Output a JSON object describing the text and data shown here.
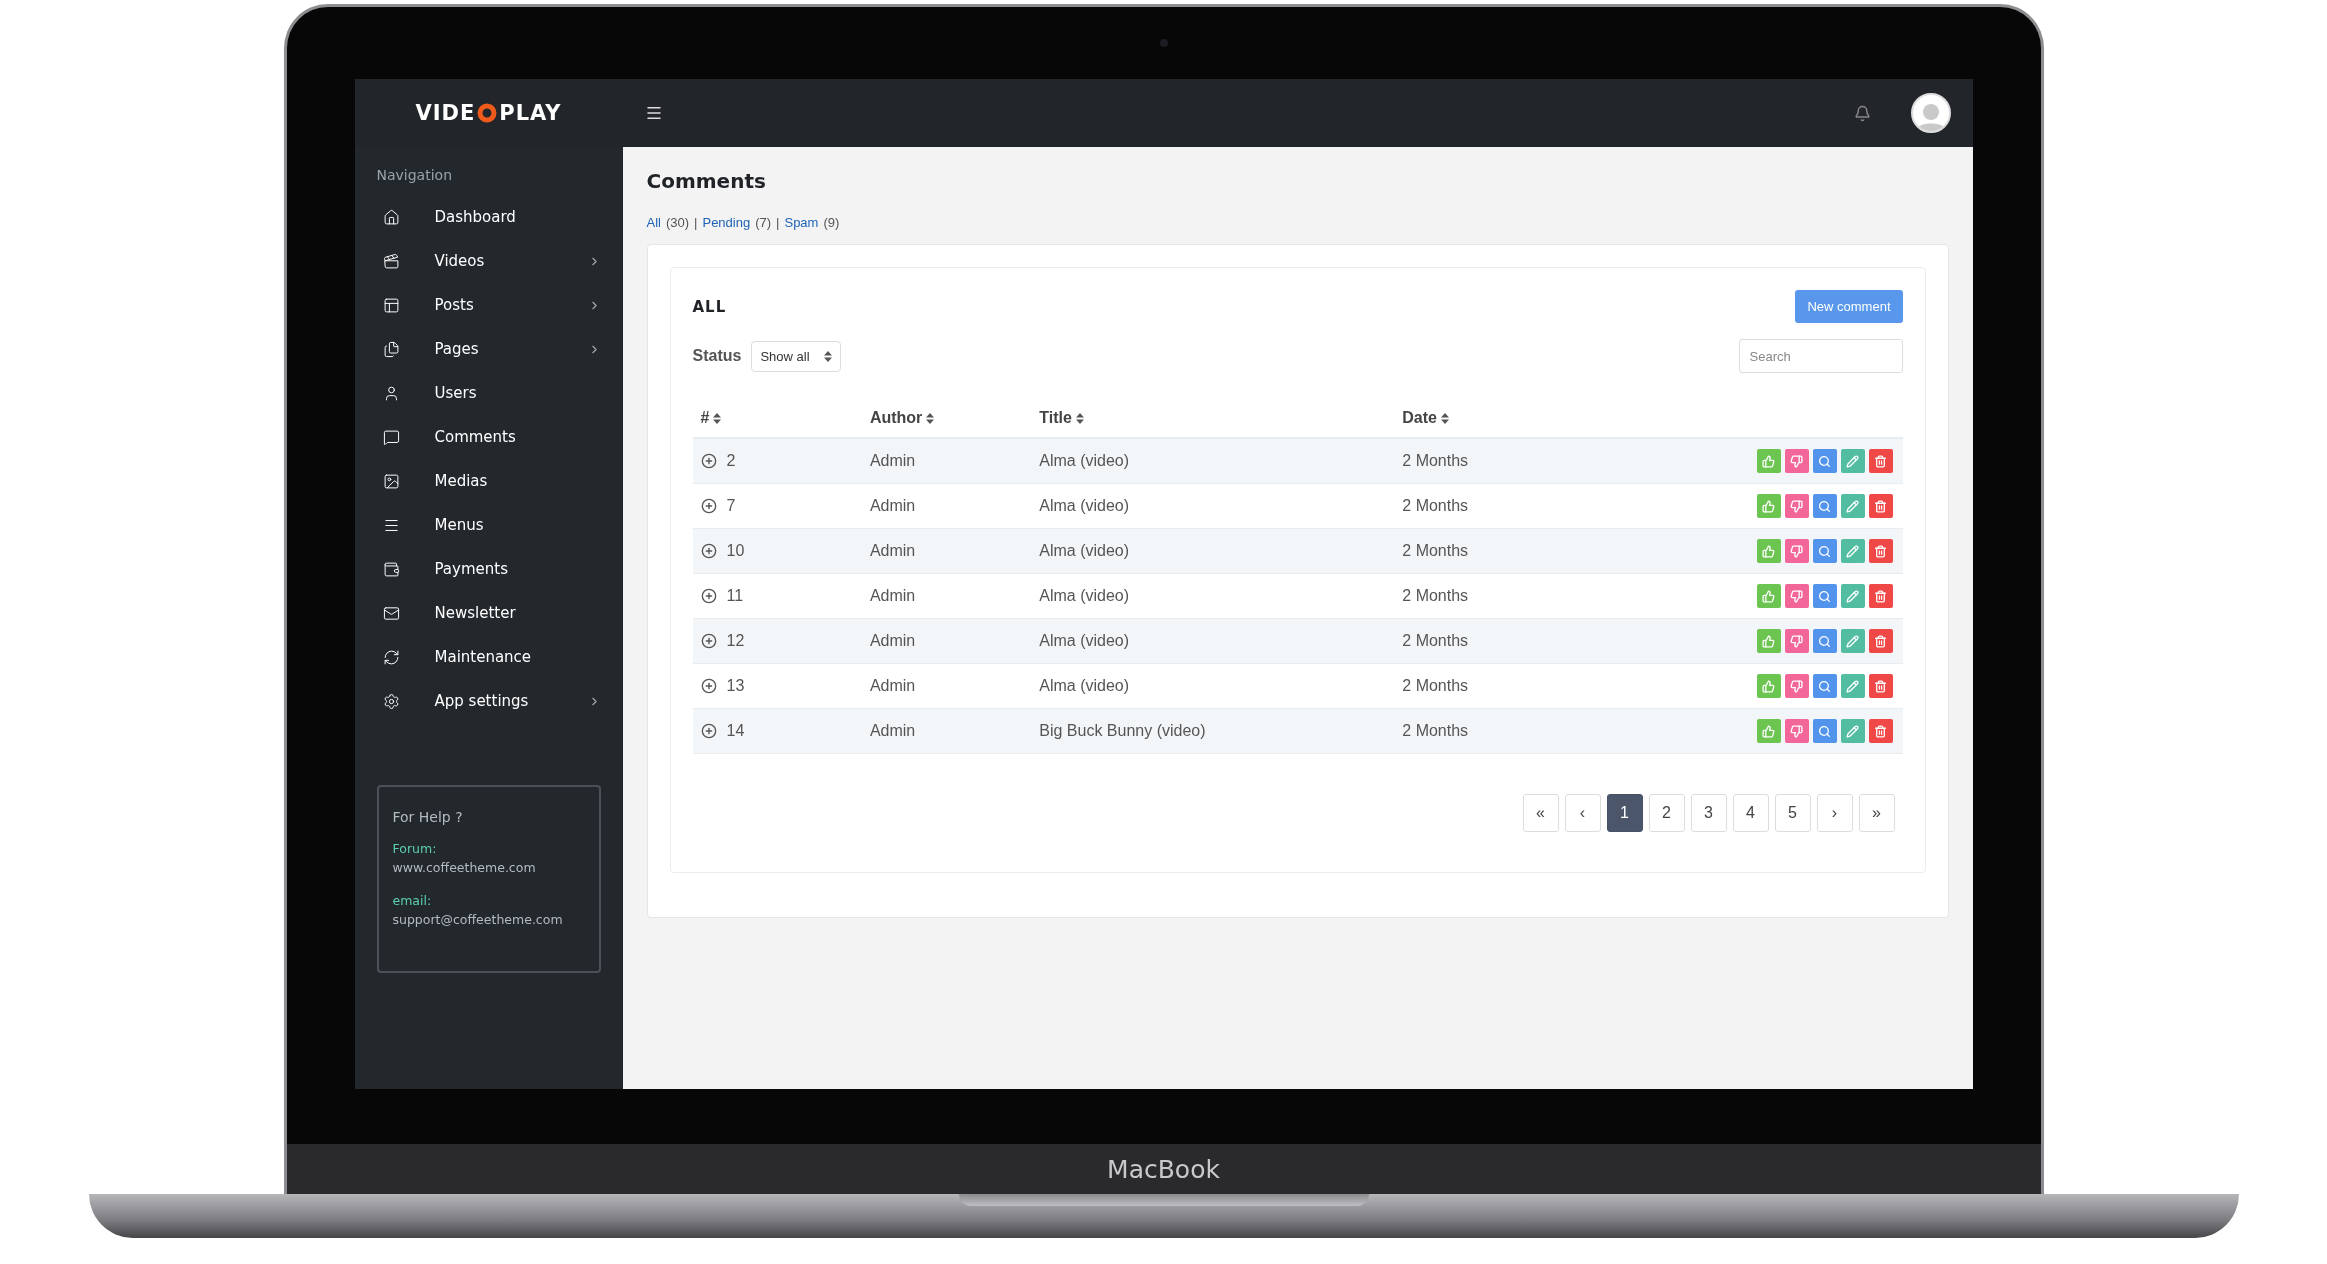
{
  "device": {
    "label": "MacBook"
  },
  "logo": {
    "left": "VIDE",
    "right": "PLAY"
  },
  "sidebar": {
    "heading": "Navigation",
    "items": [
      {
        "label": "Dashboard",
        "expandable": false
      },
      {
        "label": "Videos",
        "expandable": true
      },
      {
        "label": "Posts",
        "expandable": true
      },
      {
        "label": "Pages",
        "expandable": true
      },
      {
        "label": "Users",
        "expandable": false
      },
      {
        "label": "Comments",
        "expandable": false
      },
      {
        "label": "Medias",
        "expandable": false
      },
      {
        "label": "Menus",
        "expandable": false
      },
      {
        "label": "Payments",
        "expandable": false
      },
      {
        "label": "Newsletter",
        "expandable": false
      },
      {
        "label": "Maintenance",
        "expandable": false
      },
      {
        "label": "App settings",
        "expandable": true
      }
    ],
    "help": {
      "title": "For Help ?",
      "contacts": [
        {
          "label": "Forum:",
          "value": "www.coffeetheme.com"
        },
        {
          "label": "email:",
          "value": "support@coffeetheme.com"
        }
      ]
    }
  },
  "page": {
    "title": "Comments",
    "separator": "|",
    "filters": [
      {
        "label": "All",
        "count": "(30)"
      },
      {
        "label": "Pending",
        "count": "(7)"
      },
      {
        "label": "Spam",
        "count": "(9)"
      }
    ]
  },
  "card": {
    "title": "ALL",
    "new_button": "New comment",
    "status_label": "Status",
    "status_value": "Show all",
    "search": {
      "placeholder": "Search"
    }
  },
  "table": {
    "columns": [
      {
        "label": "#",
        "sortable": true
      },
      {
        "label": "Author",
        "sortable": true
      },
      {
        "label": "Title",
        "sortable": true
      },
      {
        "label": "Date",
        "sortable": true
      }
    ],
    "row_actions": [
      {
        "kind": "like",
        "color": "#6cc551"
      },
      {
        "kind": "dislike",
        "color": "#f3669a"
      },
      {
        "kind": "view",
        "color": "#5293ec"
      },
      {
        "kind": "edit",
        "color": "#52bda1"
      },
      {
        "kind": "delete",
        "color": "#f04747"
      }
    ],
    "rows": [
      {
        "id": "2",
        "author": "Admin",
        "title": "Alma (video)",
        "date": "2 Months"
      },
      {
        "id": "7",
        "author": "Admin",
        "title": "Alma (video)",
        "date": "2 Months"
      },
      {
        "id": "10",
        "author": "Admin",
        "title": "Alma (video)",
        "date": "2 Months"
      },
      {
        "id": "11",
        "author": "Admin",
        "title": "Alma (video)",
        "date": "2 Months"
      },
      {
        "id": "12",
        "author": "Admin",
        "title": "Alma (video)",
        "date": "2 Months"
      },
      {
        "id": "13",
        "author": "Admin",
        "title": "Alma (video)",
        "date": "2 Months"
      },
      {
        "id": "14",
        "author": "Admin",
        "title": "Big Buck Bunny (video)",
        "date": "2 Months"
      }
    ]
  },
  "pagination": [
    {
      "label": "«",
      "selected": false
    },
    {
      "label": "‹",
      "selected": false
    },
    {
      "label": "1",
      "selected": true
    },
    {
      "label": "2",
      "selected": false
    },
    {
      "label": "3",
      "selected": false
    },
    {
      "label": "4",
      "selected": false
    },
    {
      "label": "5",
      "selected": false
    },
    {
      "label": "›",
      "selected": false
    },
    {
      "label": "»",
      "selected": false
    }
  ]
}
